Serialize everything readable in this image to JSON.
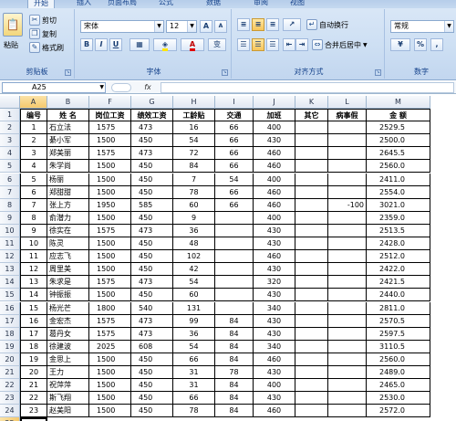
{
  "ribbon": {
    "tabs": [
      "开始",
      "插入",
      "页面布局",
      "公式",
      "数据",
      "审阅",
      "视图"
    ],
    "active_tab": 0,
    "clipboard": {
      "paste": "粘贴",
      "cut": "剪切",
      "copy": "复制",
      "format_painter": "格式刷",
      "label": "剪贴板"
    },
    "font": {
      "name": "宋体",
      "size": "12",
      "grow": "A",
      "shrink": "A",
      "bold": "B",
      "italic": "I",
      "underline": "U",
      "label": "字体",
      "font_color_letter": "A",
      "change_case": "变"
    },
    "alignment": {
      "wrap_text": "自动换行",
      "merge_center": "合并后居中",
      "label": "对齐方式"
    },
    "number": {
      "format": "常规",
      "percent": "%",
      "comma": ",",
      "label": "数字"
    }
  },
  "formula_bar": {
    "name_box": "A25",
    "fx": "fx",
    "content": ""
  },
  "grid": {
    "columns": [
      "A",
      "B",
      "F",
      "G",
      "H",
      "I",
      "J",
      "K",
      "L",
      "M"
    ],
    "selected_column": "A",
    "selected_row": "25",
    "headers": [
      "编号",
      "姓  名",
      "岗位工资",
      "绩效工资",
      "工龄贴",
      "交通",
      "加班",
      "其它",
      "病事假",
      "金  额"
    ],
    "rows": [
      [
        "1",
        "石立法",
        "1575",
        "473",
        "16",
        "66",
        "400",
        "",
        "",
        "2529.5"
      ],
      [
        "2",
        "綦小军",
        "1500",
        "450",
        "54",
        "66",
        "430",
        "",
        "",
        "2500.0"
      ],
      [
        "3",
        "郑美丽",
        "1575",
        "473",
        "72",
        "66",
        "460",
        "",
        "",
        "2645.5"
      ],
      [
        "4",
        "朱学尚",
        "1500",
        "450",
        "84",
        "66",
        "460",
        "",
        "",
        "2560.0"
      ],
      [
        "5",
        "杨丽",
        "1500",
        "450",
        "7",
        "54",
        "400",
        "",
        "",
        "2411.0"
      ],
      [
        "6",
        "郑甜甜",
        "1500",
        "450",
        "78",
        "66",
        "460",
        "",
        "",
        "2554.0"
      ],
      [
        "7",
        "张上方",
        "1950",
        "585",
        "60",
        "66",
        "460",
        "",
        "-100",
        "3021.0"
      ],
      [
        "8",
        "俞潜力",
        "1500",
        "450",
        "9",
        "",
        "400",
        "",
        "",
        "2359.0"
      ],
      [
        "9",
        "徐实在",
        "1575",
        "473",
        "36",
        "",
        "430",
        "",
        "",
        "2513.5"
      ],
      [
        "10",
        "陈灵",
        "1500",
        "450",
        "48",
        "",
        "430",
        "",
        "",
        "2428.0"
      ],
      [
        "11",
        "应志飞",
        "1500",
        "450",
        "102",
        "",
        "460",
        "",
        "",
        "2512.0"
      ],
      [
        "12",
        "周里美",
        "1500",
        "450",
        "42",
        "",
        "430",
        "",
        "",
        "2422.0"
      ],
      [
        "13",
        "朱求是",
        "1575",
        "473",
        "54",
        "",
        "320",
        "",
        "",
        "2421.5"
      ],
      [
        "14",
        "钟振振",
        "1500",
        "450",
        "60",
        "",
        "430",
        "",
        "",
        "2440.0"
      ],
      [
        "15",
        "杨光芒",
        "1800",
        "540",
        "131",
        "",
        "340",
        "",
        "",
        "2811.0"
      ],
      [
        "16",
        "金宏杰",
        "1575",
        "473",
        "99",
        "84",
        "430",
        "",
        "",
        "2570.5"
      ],
      [
        "17",
        "葛丹女",
        "1575",
        "473",
        "36",
        "84",
        "430",
        "",
        "",
        "2597.5"
      ],
      [
        "18",
        "徐建波",
        "2025",
        "608",
        "54",
        "84",
        "340",
        "",
        "",
        "3110.5"
      ],
      [
        "19",
        "金思上",
        "1500",
        "450",
        "66",
        "84",
        "460",
        "",
        "",
        "2560.0"
      ],
      [
        "20",
        "王力",
        "1500",
        "450",
        "31",
        "78",
        "430",
        "",
        "",
        "2489.0"
      ],
      [
        "21",
        "祝萍萍",
        "1500",
        "450",
        "31",
        "84",
        "400",
        "",
        "",
        "2465.0"
      ],
      [
        "22",
        "斯飞翔",
        "1500",
        "450",
        "66",
        "84",
        "430",
        "",
        "",
        "2530.0"
      ],
      [
        "23",
        "赵美阳",
        "1500",
        "450",
        "78",
        "84",
        "460",
        "",
        "",
        "2572.0"
      ]
    ]
  },
  "colors": {
    "ribbon_text": "#15428b",
    "header_bg": "#e1e8f2",
    "selected_header": "#f5c96d"
  }
}
